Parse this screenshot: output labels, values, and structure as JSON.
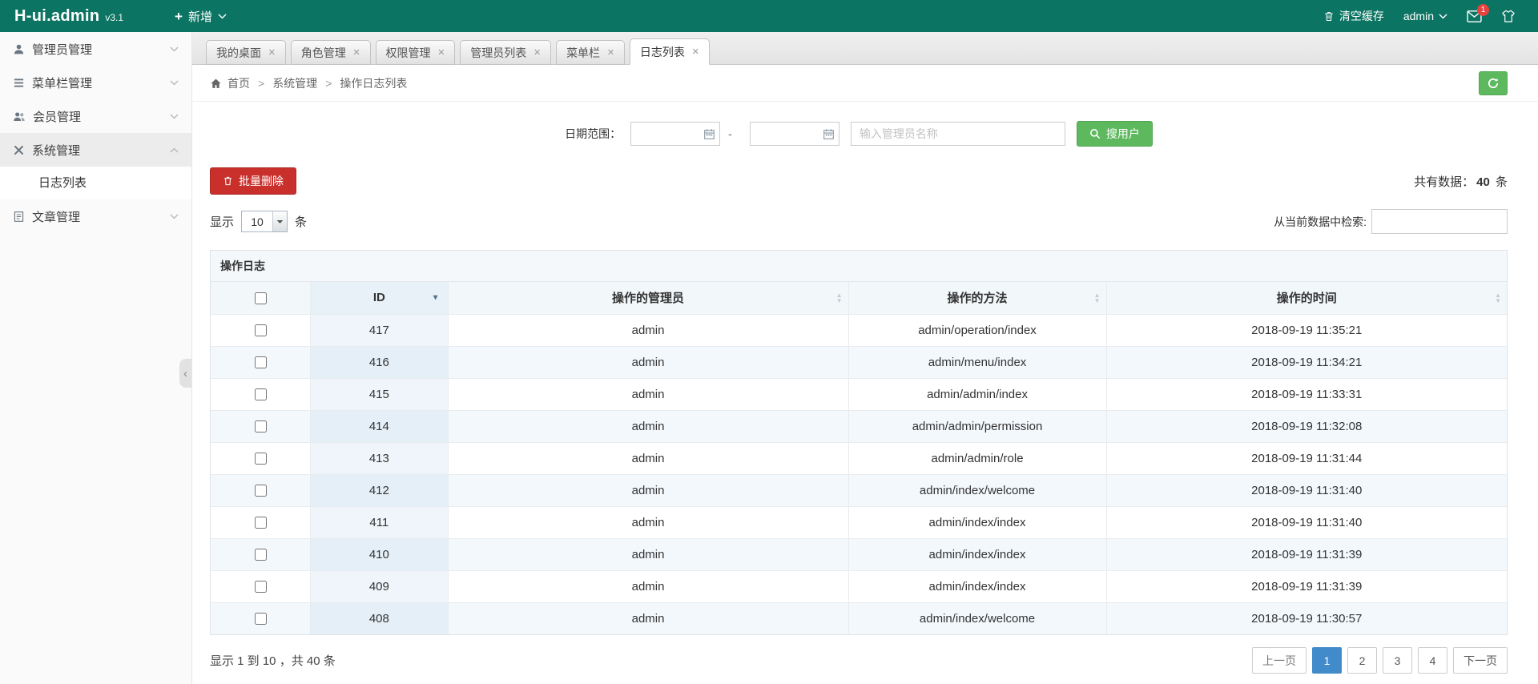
{
  "header": {
    "brand": "H-ui.admin",
    "version": "v3.1",
    "add_label": "新增",
    "clear_cache_label": "清空缓存",
    "username": "admin",
    "mail_badge": "1"
  },
  "colors": {
    "header_bg": "#0c7463",
    "primary_green": "#5eb95e",
    "danger_red": "#c9302c",
    "active_page_blue": "#428bca",
    "stripe_blue": "#f3f8fc"
  },
  "icons": {
    "plus": "+",
    "close": "×",
    "breadcrumb_sep": ">",
    "collapse": "‹",
    "sort_asc": "▲",
    "sort_desc": "▼"
  },
  "sidebar": {
    "items": [
      {
        "label": "管理员管理"
      },
      {
        "label": "菜单栏管理"
      },
      {
        "label": "会员管理"
      },
      {
        "label": "系统管理",
        "expanded": true,
        "children": [
          {
            "label": "日志列表"
          }
        ]
      },
      {
        "label": "文章管理"
      }
    ]
  },
  "tabs": [
    {
      "label": "我的桌面"
    },
    {
      "label": "角色管理"
    },
    {
      "label": "权限管理"
    },
    {
      "label": "管理员列表"
    },
    {
      "label": "菜单栏"
    },
    {
      "label": "日志列表",
      "active": true
    }
  ],
  "breadcrumb": {
    "items": [
      "首页",
      "系统管理",
      "操作日志列表"
    ]
  },
  "search": {
    "date_label": "日期范围：",
    "date_from": "",
    "date_to": "",
    "date_separator": "-",
    "name_placeholder": "输入管理员名称",
    "button_label": "搜用户"
  },
  "toolbar": {
    "delete_label": "批量删除",
    "total_prefix": "共有数据：",
    "total_value": "40",
    "total_suffix": " 条"
  },
  "length": {
    "prefix": "显示",
    "value": "10",
    "suffix": "条"
  },
  "filter": {
    "label": "从当前数据中检索:",
    "value": ""
  },
  "table": {
    "caption": "操作日志",
    "columns": [
      "ID",
      "操作的管理员",
      "操作的方法",
      "操作的时间"
    ],
    "rows": [
      {
        "id": "417",
        "admin": "admin",
        "method": "admin/operation/index",
        "time": "2018-09-19 11:35:21"
      },
      {
        "id": "416",
        "admin": "admin",
        "method": "admin/menu/index",
        "time": "2018-09-19 11:34:21"
      },
      {
        "id": "415",
        "admin": "admin",
        "method": "admin/admin/index",
        "time": "2018-09-19 11:33:31"
      },
      {
        "id": "414",
        "admin": "admin",
        "method": "admin/admin/permission",
        "time": "2018-09-19 11:32:08"
      },
      {
        "id": "413",
        "admin": "admin",
        "method": "admin/admin/role",
        "time": "2018-09-19 11:31:44"
      },
      {
        "id": "412",
        "admin": "admin",
        "method": "admin/index/welcome",
        "time": "2018-09-19 11:31:40"
      },
      {
        "id": "411",
        "admin": "admin",
        "method": "admin/index/index",
        "time": "2018-09-19 11:31:40"
      },
      {
        "id": "410",
        "admin": "admin",
        "method": "admin/index/index",
        "time": "2018-09-19 11:31:39"
      },
      {
        "id": "409",
        "admin": "admin",
        "method": "admin/index/index",
        "time": "2018-09-19 11:31:39"
      },
      {
        "id": "408",
        "admin": "admin",
        "method": "admin/index/welcome",
        "time": "2018-09-19 11:30:57"
      }
    ]
  },
  "footer": {
    "info": "显示 1 到 10 ，共 40 条",
    "prev": "上一页",
    "pages": [
      "1",
      "2",
      "3",
      "4"
    ],
    "active_page": "1",
    "next": "下一页"
  }
}
